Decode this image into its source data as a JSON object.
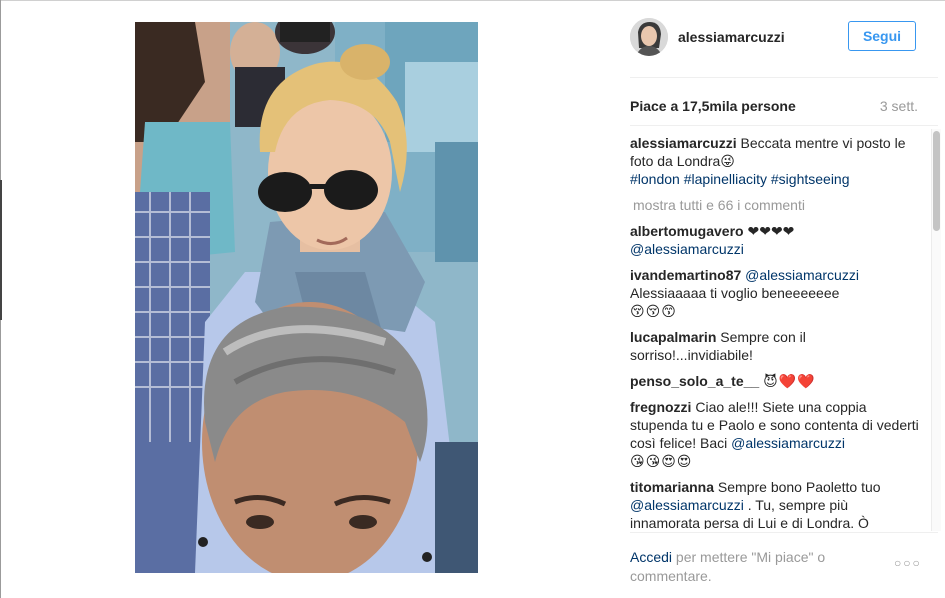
{
  "post": {
    "username": "alessiamarcuzzi",
    "follow_label": "Segui",
    "likes_text": "Piace a 17,5mila persone",
    "time_ago": "3 sett."
  },
  "caption": {
    "username": "alessiamarcuzzi",
    "text": "Beccata mentre vi posto le foto da Londra",
    "emoji": "😜",
    "tags": [
      "#london",
      "#lapinelliacity",
      "#sightseeing"
    ]
  },
  "load_more_label": "mostra tutti e 66 i commenti",
  "comments": [
    {
      "username": "albertomugavero",
      "text": "❤❤❤❤",
      "mention": "@alessiamarcuzzi",
      "after": "",
      "emoji": ""
    },
    {
      "username": "ivandemartino87",
      "mention": "@alessiamarcuzzi",
      "text": "Alessiaaaaa ti voglio beneeeeeee",
      "emoji": "😚😚😙"
    },
    {
      "username": "lucapalmarin",
      "text": "Sempre con il sorriso!...invidiabile!",
      "emoji": ""
    },
    {
      "username": "penso_solo_a_te__",
      "text": "",
      "emoji": "😈❤️❤️"
    },
    {
      "username": "fregnozzi",
      "text": "Ciao ale!!! Siete una coppia stupenda tu e Paolo e sono contenta di vederti così felice! Baci",
      "mention": "@alessiamarcuzzi",
      "emoji": "😘😘😍😍"
    },
    {
      "username": "titomarianna",
      "text": "Sempre bono Paoletto tuo",
      "mention": "@alessiamarcuzzi",
      "after": ". Tu, sempre più innamorata persa di Lui e di Londra. Ò"
    }
  ],
  "footer": {
    "login_label": "Accedi",
    "rest": "per mettere \"Mi piace\" o commentare."
  },
  "more_icon": "ellipsis-icon"
}
